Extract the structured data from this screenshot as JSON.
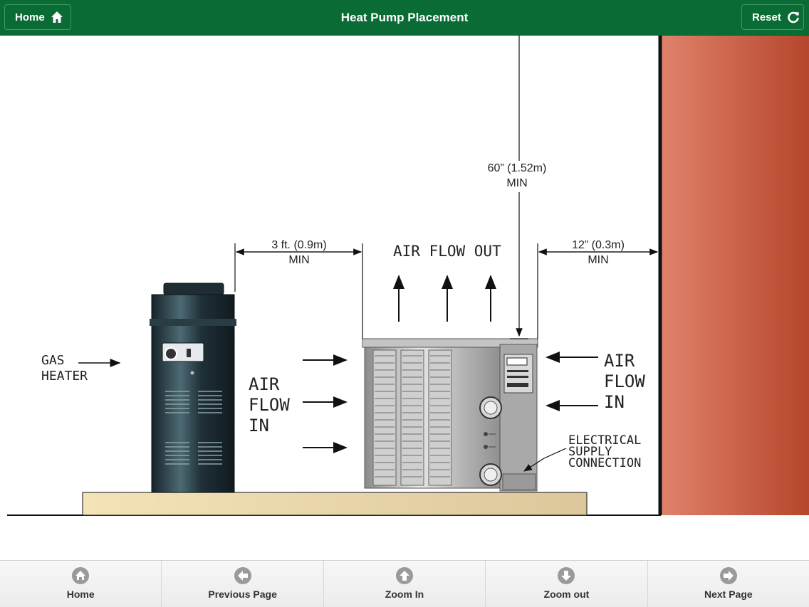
{
  "header": {
    "title": "Heat Pump Placement",
    "home_label": "Home",
    "reset_label": "Reset"
  },
  "diagram": {
    "gas_heater_line1": "GAS",
    "gas_heater_line2": "HEATER",
    "dim_left_value": "3 ft. (0.9m)",
    "dim_left_min": "MIN",
    "air_flow_out": "AIR FLOW OUT",
    "dim_top_value": "60” (1.52m)",
    "dim_top_min": "MIN",
    "dim_right_value": "12” (0.3m)",
    "dim_right_min": "MIN",
    "air_flow_in_left_1": "AIR",
    "air_flow_in_left_2": "FLOW",
    "air_flow_in_left_3": "IN",
    "air_flow_in_right_1": "AIR",
    "air_flow_in_right_2": "FLOW",
    "air_flow_in_right_3": "IN",
    "electrical_1": "ELECTRICAL",
    "electrical_2": "SUPPLY",
    "electrical_3": "CONNECTION"
  },
  "footer": {
    "items": [
      {
        "label": "Home",
        "icon": "home-icon"
      },
      {
        "label": "Previous Page",
        "icon": "arrow-left-icon"
      },
      {
        "label": "Zoom In",
        "icon": "arrow-up-icon"
      },
      {
        "label": "Zoom out",
        "icon": "arrow-down-icon"
      },
      {
        "label": "Next Page",
        "icon": "arrow-right-icon"
      }
    ]
  },
  "colors": {
    "header_bg": "#0b6b35",
    "wall": "#c6553a",
    "pad": "#efdcb0",
    "heater": "#1f2f36"
  }
}
